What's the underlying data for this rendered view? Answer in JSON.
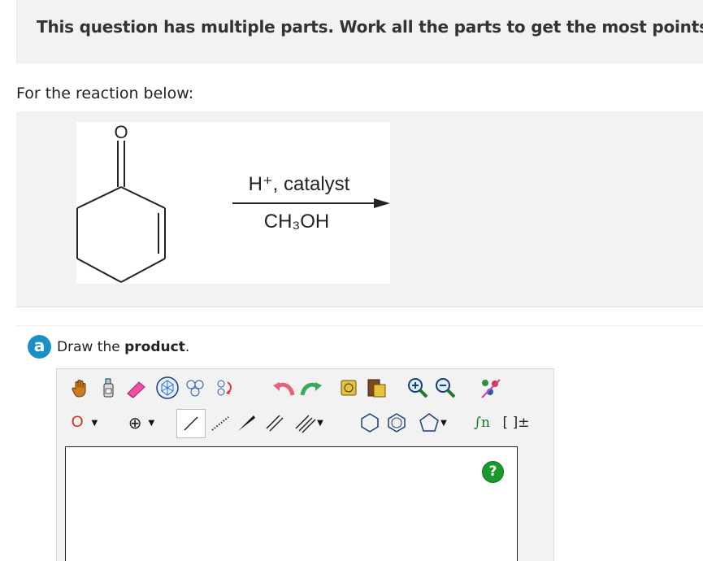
{
  "banner": {
    "text": "This question has multiple parts. Work all the parts to get the most points."
  },
  "prompt": {
    "text": "For the reaction below:"
  },
  "reaction": {
    "reagent_top": "H⁺, catalyst",
    "reagent_bottom": "CH₃OH",
    "reactant_atom_label": "O"
  },
  "part": {
    "label": "a",
    "instruction_prefix": "Draw the ",
    "instruction_bold": "product",
    "instruction_suffix": "."
  },
  "editor": {
    "atom_selector_value": "O",
    "charge_selector_symbol": "⊕",
    "template_label": "∫n",
    "bracket_label": "[ ]±",
    "help_label": "?",
    "top_tools": [
      "hand-tool",
      "eraser-bottle-tool",
      "eraser-tool",
      "ring-template-tool",
      "chain-template-tool",
      "rotate-template-tool",
      "undo-tool",
      "redo-tool",
      "copy-tool",
      "paste-tool",
      "zoom-in-tool",
      "zoom-out-tool",
      "clean-structure-tool"
    ],
    "bottom_tools": [
      "atom-selector",
      "charge-selector",
      "single-bond-tool",
      "hashed-bond-tool",
      "wedge-bond-tool",
      "double-bond-tool",
      "triple-bond-tool",
      "cyclohexane-tool",
      "benzene-tool",
      "cyclopentane-tool",
      "sgroup-tool",
      "bracket-tool"
    ]
  }
}
